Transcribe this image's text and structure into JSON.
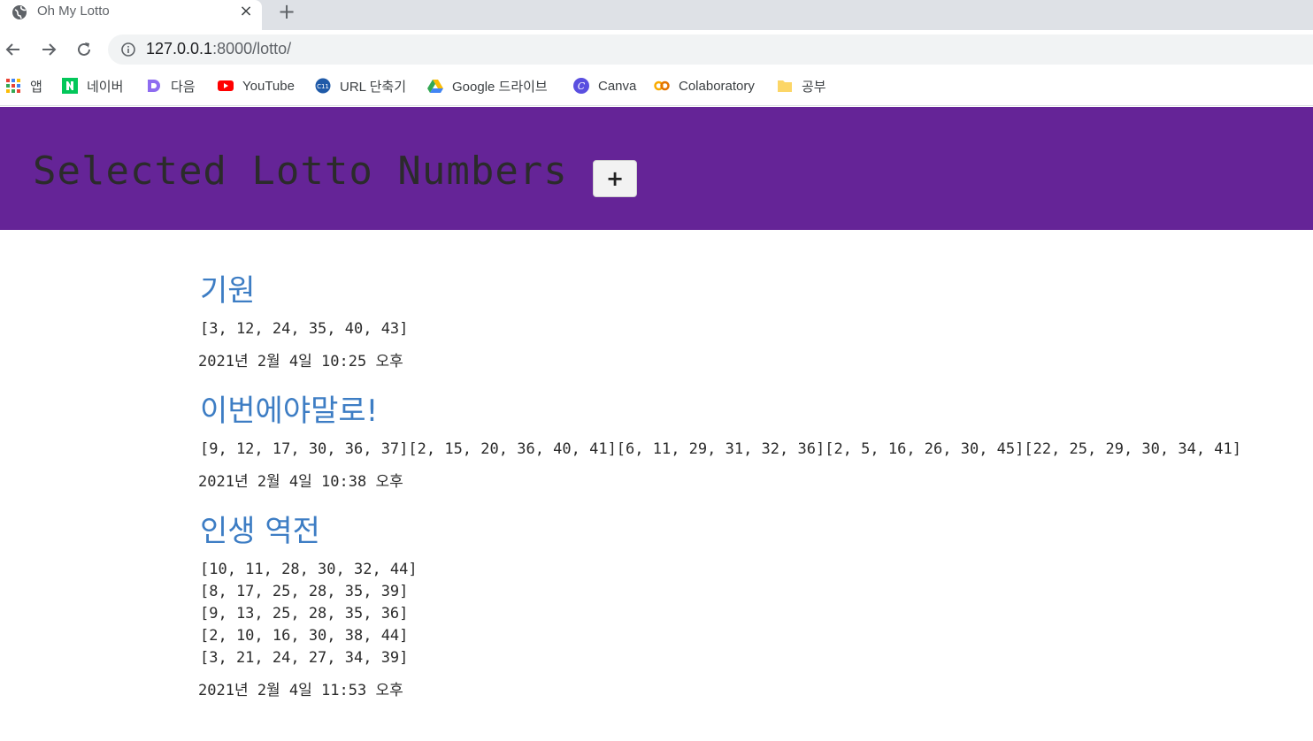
{
  "browser": {
    "tab": {
      "title": "Oh My Lotto",
      "close": "×",
      "favicon": "globe-icon"
    },
    "new_tab": "+",
    "nav": {
      "back": "back-arrow-icon",
      "forward": "forward-arrow-icon",
      "reload": "reload-icon"
    },
    "url": {
      "host": "127.0.0.1",
      "rest": ":8000/lotto/"
    },
    "bookmarks": [
      {
        "label": "앱",
        "icon": "apps-grid-icon"
      },
      {
        "label": "네이버",
        "icon": "naver-icon"
      },
      {
        "label": "다음",
        "icon": "daum-icon"
      },
      {
        "label": "YouTube",
        "icon": "youtube-icon"
      },
      {
        "label": "URL 단축기",
        "icon": "url-shortener-icon"
      },
      {
        "label": "Google 드라이브",
        "icon": "google-drive-icon"
      },
      {
        "label": "Canva",
        "icon": "canva-icon"
      },
      {
        "label": "Colaboratory",
        "icon": "colab-icon"
      },
      {
        "label": "공부",
        "icon": "folder-icon"
      }
    ]
  },
  "header": {
    "title": "Selected Lotto Numbers",
    "add_label": "+"
  },
  "posts": [
    {
      "title": "기원",
      "lines": [
        "[3, 12, 24, 35, 40, 43]"
      ],
      "date": "2021년 2월 4일 10:25 오후"
    },
    {
      "title": "이번에야말로!",
      "lines": [
        "[9, 12, 17, 30, 36, 37][2, 15, 20, 36, 40, 41][6, 11, 29, 31, 32, 36][2, 5, 16, 26, 30, 45][22, 25, 29, 30, 34, 41]"
      ],
      "date": "2021년 2월 4일 10:38 오후"
    },
    {
      "title": "인생 역전",
      "lines": [
        "[10, 11, 28, 30, 32, 44]",
        "[8, 17, 25, 28, 35, 39]",
        "[9, 13, 25, 28, 35, 36]",
        "[2, 10, 16, 30, 38, 44]",
        "[3, 21, 24, 27, 34, 39]"
      ],
      "date": "2021년 2월 4일 11:53 오후"
    }
  ]
}
